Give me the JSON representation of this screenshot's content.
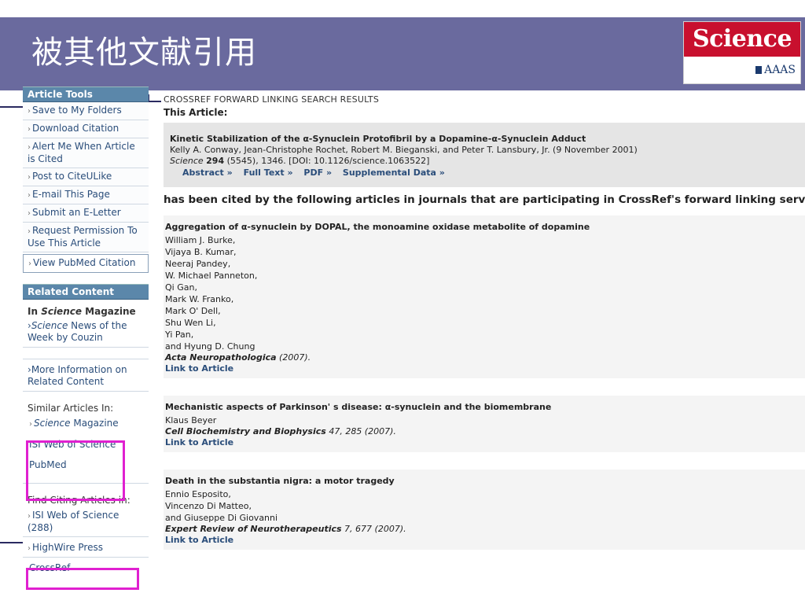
{
  "slide": {
    "title": "被其他文献引用"
  },
  "logo": {
    "name": "Science",
    "sub": "AAAS"
  },
  "sidebar": {
    "article_tools_heading": "Article Tools",
    "tools": [
      "Save to My Folders",
      "Download Citation",
      "Alert Me When Article is Cited",
      "Post to CiteULike",
      "E-mail This Page",
      "Submit an E-Letter",
      "Request Permission To Use This Article",
      "View PubMed Citation"
    ],
    "related_heading": "Related Content",
    "in_science_prefix": "In ",
    "in_science_em": "Science",
    "in_science_suffix": " Magazine",
    "science_news_em": "Science",
    "science_news_rest": " News of the Week by Couzin",
    "more_info": "More Information on Related Content",
    "similar_label": "Similar Articles In:",
    "similar_science_em": "Science",
    "similar_science_rest": " Magazine",
    "similar_isi": "ISI Web of Science",
    "similar_pubmed": "PubMed",
    "find_citing_label": "Find Citing Articles in:",
    "citing_isi": "ISI Web of Science (288)",
    "citing_highwire": "HighWire Press",
    "citing_crossref": "CrossRef",
    "arrow": "›"
  },
  "main": {
    "crossref_heading": "CROSSREF FORWARD LINKING SEARCH RESULTS",
    "this_article_label": "This Article:",
    "article": {
      "title": "Kinetic Stabilization of the α-Synuclein Protofibril by a Dopamine-α-Synuclein Adduct",
      "authors": "Kelly A. Conway, Jean-Christophe Rochet, Robert M. Bieganski, and Peter T. Lansbury, Jr. (9 November 2001)",
      "journal_em": "Science",
      "volume": "294",
      "rest": "(5545), 1346. [DOI: 10.1126/science.1063522]",
      "links": [
        "Abstract »",
        "Full Text »",
        "PDF »",
        "Supplemental Data »"
      ]
    },
    "cited_by_text": "has been cited by the following articles in journals that are participating in CrossRef's forward linking service:",
    "citations": [
      {
        "title": "Aggregation of α-synuclein by DOPAL, the monoamine oxidase metabolite of dopamine",
        "authors": [
          "William J. Burke,",
          "Vijaya B. Kumar,",
          "Neeraj Pandey,",
          "W. Michael Panneton,",
          "Qi Gan,",
          "Mark W. Franko,",
          "Mark O' Dell,",
          "Shu Wen Li,",
          "Yi Pan,",
          "and Hyung D. Chung"
        ],
        "journal": "Acta Neuropathologica",
        "details": " (2007).",
        "link": "Link to Article"
      },
      {
        "title": "Mechanistic aspects of Parkinson' s disease: α-synuclein and the biomembrane",
        "authors": [
          "Klaus Beyer"
        ],
        "journal": "Cell Biochemistry and Biophysics",
        "details": " 47, 285 (2007).",
        "link": "Link to Article"
      },
      {
        "title": "Death in the substantia nigra: a motor tragedy",
        "authors": [
          "Ennio Esposito,",
          "Vincenzo Di Matteo,",
          "and Giuseppe Di Giovanni"
        ],
        "journal": "Expert Review of Neurotherapeutics",
        "details": " 7, 677 (2007).",
        "link": "Link to Article"
      }
    ]
  },
  "colors": {
    "header_bg": "#6a6a9e",
    "highlight": "#e020d0",
    "sidebar_head": "#5b87aa",
    "link": "#2a4d7a"
  }
}
